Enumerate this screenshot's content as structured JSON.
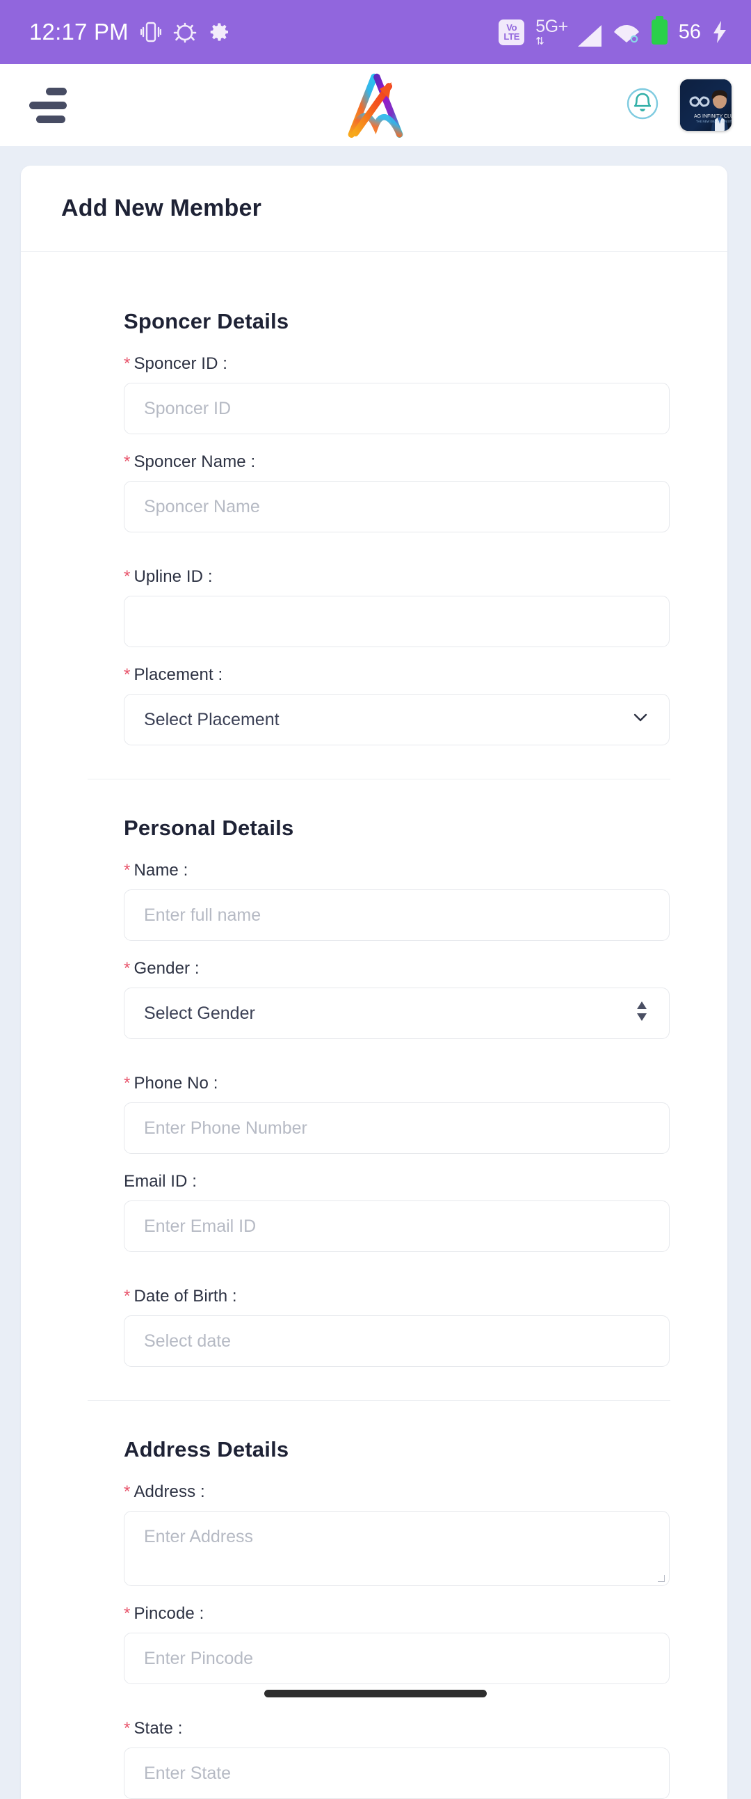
{
  "status_bar": {
    "time": "12:17 PM",
    "icons_left": [
      "vibrate-icon",
      "android-debug-icon",
      "gear-icon"
    ],
    "volte_top": "Vo",
    "volte_bottom": "LTE",
    "network": "5G+",
    "network_arrows": "⇅",
    "icons_right": [
      "volte-icon",
      "signal-icon",
      "wifi-icon",
      "battery-icon",
      "charging-icon"
    ],
    "battery_level": "56",
    "background_color": "#9166dd"
  },
  "header": {
    "menu_icon": "hamburger-menu-icon",
    "logo_icon": "app-logo-icon",
    "notification_icon": "bell-icon",
    "avatar_icon": "user-avatar"
  },
  "card": {
    "title": "Add New Member"
  },
  "sections": [
    {
      "title": "Sponcer Details",
      "fields": [
        {
          "label": "Sponcer ID :",
          "required": true,
          "placeholder": "Sponcer ID",
          "type": "text",
          "name": "sponcer-id"
        },
        {
          "label": "Sponcer Name :",
          "required": true,
          "placeholder": "Sponcer Name",
          "type": "text",
          "name": "sponcer-name"
        },
        {
          "label": "Upline ID :",
          "required": true,
          "placeholder": "",
          "type": "text",
          "name": "upline-id"
        },
        {
          "label": "Placement :",
          "required": true,
          "placeholder": "Select Placement",
          "type": "select-chevron",
          "name": "placement"
        }
      ]
    },
    {
      "title": "Personal Details",
      "fields": [
        {
          "label": "Name :",
          "required": true,
          "placeholder": "Enter full name",
          "type": "text",
          "name": "name"
        },
        {
          "label": "Gender :",
          "required": true,
          "placeholder": "Select Gender",
          "type": "select-updown",
          "name": "gender"
        },
        {
          "label": "Phone No :",
          "required": true,
          "placeholder": "Enter Phone Number",
          "type": "text",
          "name": "phone-no"
        },
        {
          "label": "Email ID :",
          "required": false,
          "placeholder": "Enter Email ID",
          "type": "text",
          "name": "email-id"
        },
        {
          "label": "Date of Birth :",
          "required": true,
          "placeholder": "Select date",
          "type": "date",
          "name": "date-of-birth"
        }
      ]
    },
    {
      "title": "Address Details",
      "fields": [
        {
          "label": "Address :",
          "required": true,
          "placeholder": "Enter Address",
          "type": "textarea",
          "name": "address"
        },
        {
          "label": "Pincode :",
          "required": true,
          "placeholder": "Enter Pincode",
          "type": "text",
          "name": "pincode"
        },
        {
          "label": "State :",
          "required": true,
          "placeholder": "Enter State",
          "type": "text",
          "name": "state"
        }
      ]
    }
  ],
  "colors": {
    "accent_purple": "#9166dd",
    "required_red": "#e8546b",
    "page_background": "#e9eef6",
    "text_dark": "#1e2235",
    "placeholder": "#b6bac4"
  }
}
